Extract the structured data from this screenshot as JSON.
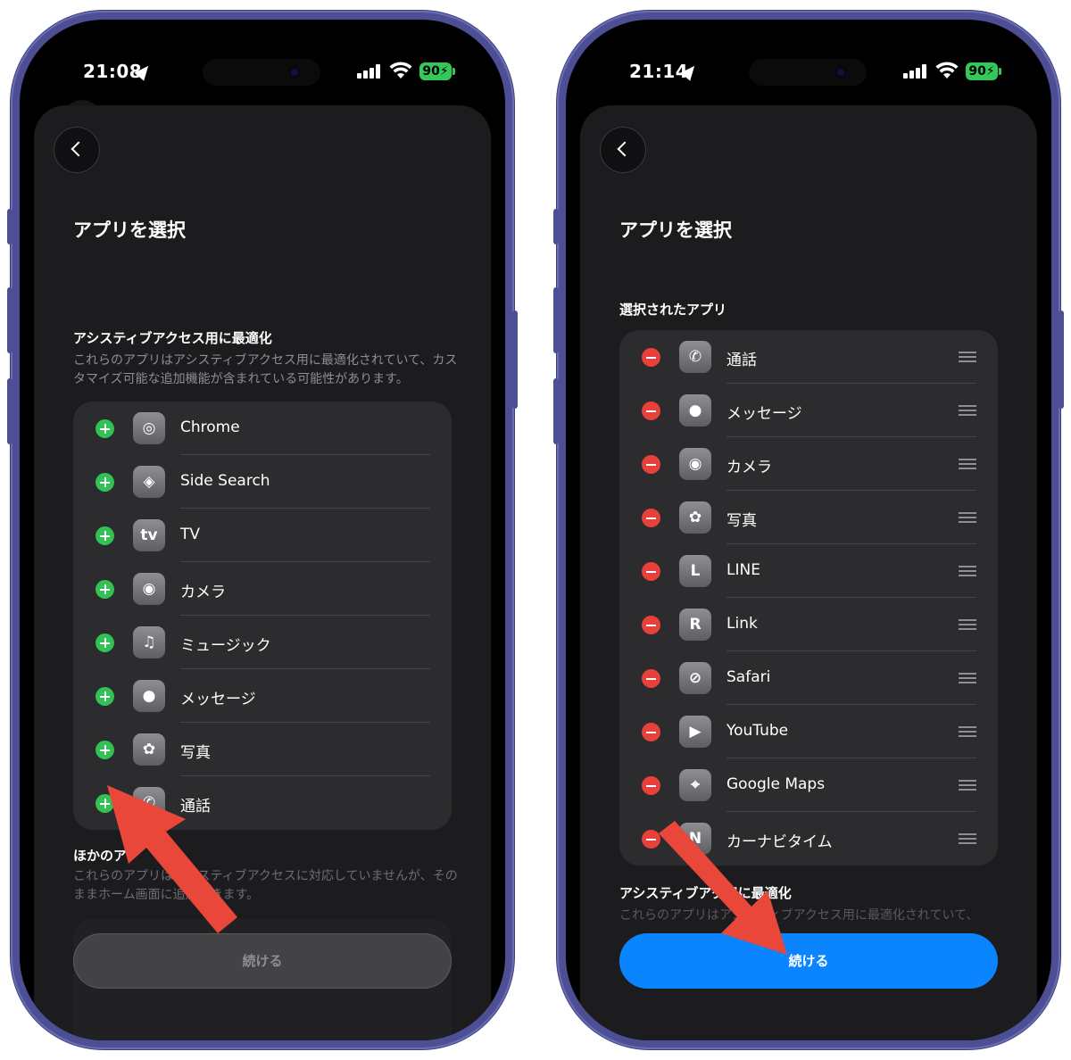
{
  "left": {
    "status": {
      "time": "21:08",
      "battery": "90"
    },
    "title": "アプリを選択",
    "optimized": {
      "heading": "アシスティブアクセス用に最適化",
      "description": "これらのアプリはアシスティブアクセス用に最適化されていて、カスタマイズ可能な追加機能が含まれている可能性があります。",
      "apps": [
        {
          "name": "Chrome",
          "icon": "chrome-icon",
          "glyph": "◎"
        },
        {
          "name": "Side Search",
          "icon": "side-search-icon",
          "glyph": "◈"
        },
        {
          "name": "TV",
          "icon": "apple-tv-icon",
          "glyph": "tv"
        },
        {
          "name": "カメラ",
          "icon": "camera-icon",
          "glyph": "◉"
        },
        {
          "name": "ミュージック",
          "icon": "music-icon",
          "glyph": "♫"
        },
        {
          "name": "メッセージ",
          "icon": "messages-icon",
          "glyph": "●"
        },
        {
          "name": "写真",
          "icon": "photos-icon",
          "glyph": "✿"
        },
        {
          "name": "通話",
          "icon": "phone-icon",
          "glyph": "✆"
        }
      ]
    },
    "others": {
      "heading": "ほかのア",
      "description": "これらのアプリはアシスティブアクセスに対応していませんが、そのままホーム画面に追加できます。"
    },
    "continue_label": "続ける"
  },
  "right": {
    "status": {
      "time": "21:14",
      "battery": "90"
    },
    "title": "アプリを選択",
    "selected": {
      "heading": "選択されたアプリ",
      "apps": [
        {
          "name": "通話",
          "icon": "phone-icon",
          "glyph": "✆"
        },
        {
          "name": "メッセージ",
          "icon": "messages-icon",
          "glyph": "●"
        },
        {
          "name": "カメラ",
          "icon": "camera-icon",
          "glyph": "◉"
        },
        {
          "name": "写真",
          "icon": "photos-icon",
          "glyph": "✿"
        },
        {
          "name": "LINE",
          "icon": "line-icon",
          "glyph": "L"
        },
        {
          "name": "Link",
          "icon": "link-icon",
          "glyph": "R"
        },
        {
          "name": "Safari",
          "icon": "safari-icon",
          "glyph": "⊘"
        },
        {
          "name": "YouTube",
          "icon": "youtube-icon",
          "glyph": "▶"
        },
        {
          "name": "Google Maps",
          "icon": "maps-pin-icon",
          "glyph": "⌖"
        },
        {
          "name": "カーナビタイム",
          "icon": "navitime-icon",
          "glyph": "N"
        }
      ]
    },
    "optimized": {
      "heading": "アシスティブアク用に最適化",
      "description": "これらのアプリはアシスティブアクセス用に最適化されていて、"
    },
    "continue_label": "続ける"
  },
  "colors": {
    "add": "#32c154",
    "remove": "#e8403a",
    "continue_active": "#0a84ff",
    "annotation_arrow": "#e8473a",
    "phone_frame": "#4c4f94"
  }
}
